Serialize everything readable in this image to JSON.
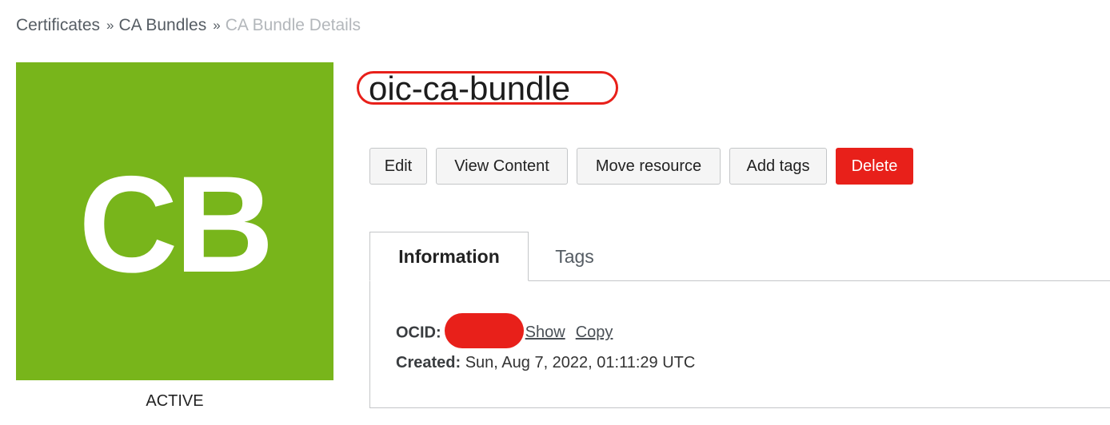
{
  "breadcrumb": {
    "items": [
      "Certificates",
      "CA Bundles"
    ],
    "separator": "»",
    "current": "CA Bundle Details"
  },
  "resource": {
    "initials": "CB",
    "state": "ACTIVE",
    "avatar_color": "#78b51b"
  },
  "page_title": "oic-ca-bundle",
  "annotation_color": "#e8201a",
  "actions": {
    "edit": "Edit",
    "view_content": "View Content",
    "move_resource": "Move resource",
    "add_tags": "Add tags",
    "delete": "Delete"
  },
  "tabs": [
    {
      "label": "Information",
      "active": true
    },
    {
      "label": "Tags",
      "active": false
    }
  ],
  "info": {
    "ocid_label": "OCID:",
    "show_label": "Show",
    "copy_label": "Copy",
    "created_label": "Created:",
    "created_value": "Sun, Aug 7, 2022, 01:11:29 UTC"
  }
}
